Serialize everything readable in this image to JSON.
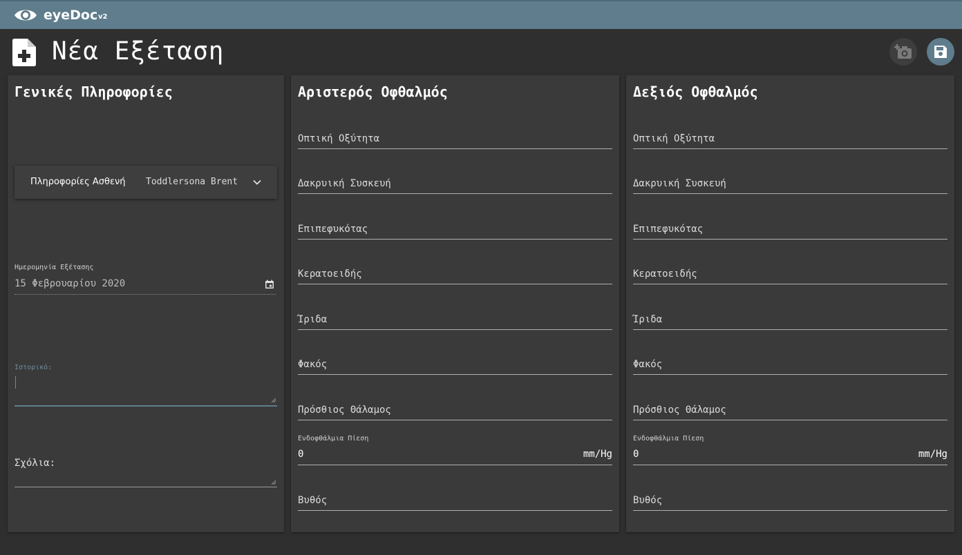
{
  "app": {
    "name": "eyeDoc",
    "version": "v2"
  },
  "page": {
    "title": "Νέα Εξέταση"
  },
  "toolbar": {
    "camera_icon": "add-photo-icon",
    "save_icon": "save-icon"
  },
  "general": {
    "title": "Γενικές Πληροφορίες",
    "patient_label": "Πληροφορίες Ασθενή",
    "patient_name": "Toddlersona Brent",
    "date_label": "Ημερομηνία Εξέτασης",
    "date_value": "15 Φεβρουαρίου 2020",
    "history_label": "Ιστορικό:",
    "history_value": "",
    "comments_label": "Σχόλια:",
    "comments_value": ""
  },
  "left_eye": {
    "title": "Αριστερός Οφθαλμός",
    "fields": [
      "Οπτική Οξύτητα",
      "Δακρυική Συσκευή",
      "Επιπεφυκότας",
      "Κερατοειδής",
      "Ίριδα",
      "Φακός",
      "Πρόσθιος Θάλαμος"
    ],
    "iop_label": "Ενδοφθάλμια Πίεση",
    "iop_value": "0",
    "iop_unit": "mm/Hg",
    "fundus": "Βυθός"
  },
  "right_eye": {
    "title": "Δεξιός Οφθαλμός",
    "fields": [
      "Οπτική Οξύτητα",
      "Δακρυική Συσκευή",
      "Επιπεφυκότας",
      "Κερατοειδής",
      "Ίριδα",
      "Φακός",
      "Πρόσθιος Θάλαμος"
    ],
    "iop_label": "Ενδοφθάλμια Πίεση",
    "iop_value": "0",
    "iop_unit": "mm/Hg",
    "fundus": "Βυθός"
  },
  "colors": {
    "accent": "#5f7d8c",
    "card": "#3a3a3a",
    "background": "#2f2f2f"
  }
}
